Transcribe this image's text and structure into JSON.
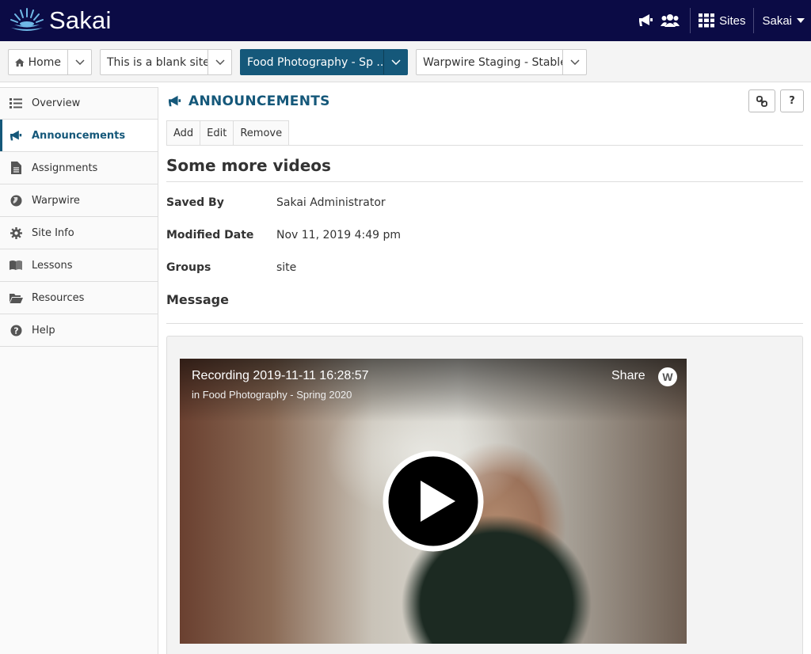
{
  "header": {
    "logo_text": "Sakai",
    "sites_label": "Sites",
    "user_label": "Sakai"
  },
  "site_tabs": [
    {
      "label": "Home",
      "active": false
    },
    {
      "label": "This is a blank site",
      "active": false
    },
    {
      "label": "Food Photography - Sp ...",
      "active": true
    },
    {
      "label": "Warpwire Staging - Stable",
      "active": false
    }
  ],
  "tools": [
    {
      "label": "Overview",
      "icon": "list-icon"
    },
    {
      "label": "Announcements",
      "icon": "megaphone-icon",
      "active": true
    },
    {
      "label": "Assignments",
      "icon": "document-icon"
    },
    {
      "label": "Warpwire",
      "icon": "globe-icon"
    },
    {
      "label": "Site Info",
      "icon": "gear-icon"
    },
    {
      "label": "Lessons",
      "icon": "book-icon"
    },
    {
      "label": "Resources",
      "icon": "folder-icon"
    },
    {
      "label": "Help",
      "icon": "question-icon"
    }
  ],
  "main": {
    "tool_title": "ANNOUNCEMENTS",
    "help_label": "?",
    "actions": {
      "add": "Add",
      "edit": "Edit",
      "remove": "Remove"
    },
    "announcement_title": "Some more videos",
    "meta": [
      {
        "label": "Saved By",
        "value": "Sakai Administrator"
      },
      {
        "label": "Modified Date",
        "value": "Nov 11, 2019 4:49 pm"
      },
      {
        "label": "Groups",
        "value": "site"
      }
    ],
    "message_label": "Message",
    "video": {
      "title": "Recording 2019-11-11 16:28:57",
      "subtitle": "in Food Photography - Spring 2020",
      "share_label": "Share",
      "logo_letter": "W"
    }
  },
  "colors": {
    "header_bg": "#0b0b45",
    "accent": "#15587a"
  }
}
